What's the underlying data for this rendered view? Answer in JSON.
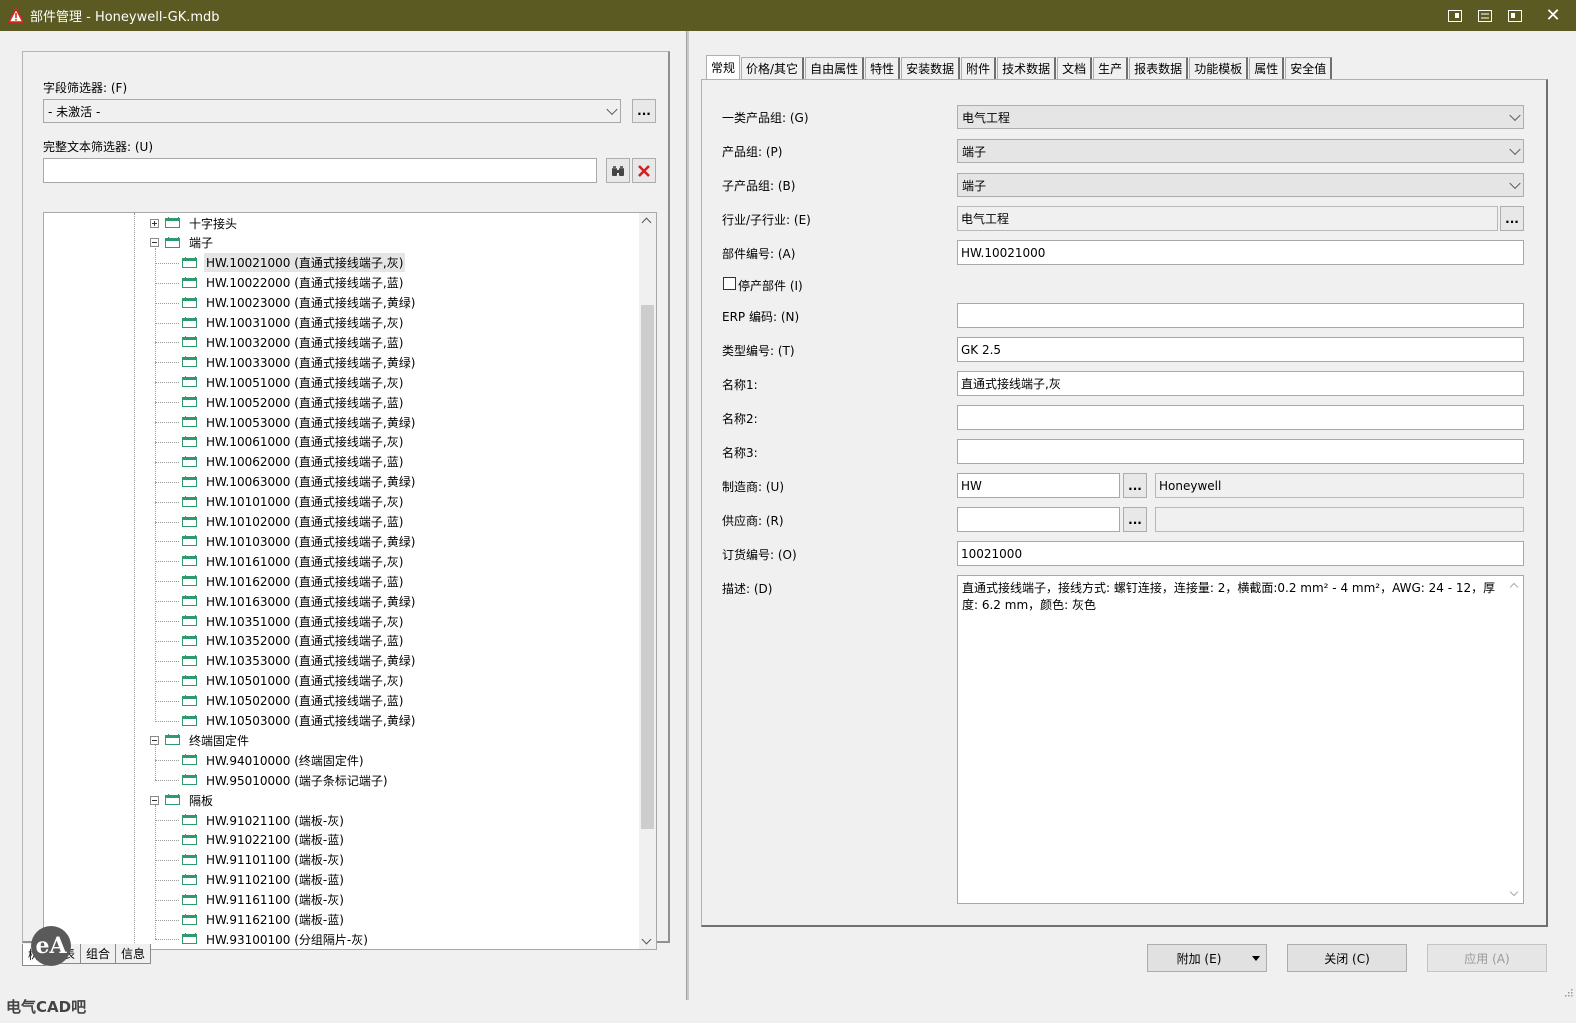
{
  "window": {
    "title": "部件管理 - Honeywell-GK.mdb",
    "buttons": [
      "restore-down",
      "maximize",
      "minimize",
      "close"
    ],
    "close_glyph": "✕"
  },
  "left": {
    "field_filter_label": "字段筛选器: (F)",
    "field_filter_value": "- 未激活 -",
    "field_filter_more": "...",
    "fulltext_filter_label": "完整文本筛选器: (U)",
    "fulltext_filter_value": "",
    "tree": {
      "groups": [
        {
          "label": "十字接头",
          "expanded": false
        },
        {
          "label": "端子",
          "expanded": true,
          "items": [
            "HW.10021000 (直通式接线端子,灰)",
            "HW.10022000 (直通式接线端子,蓝)",
            "HW.10023000 (直通式接线端子,黄绿)",
            "HW.10031000 (直通式接线端子,灰)",
            "HW.10032000 (直通式接线端子,蓝)",
            "HW.10033000 (直通式接线端子,黄绿)",
            "HW.10051000 (直通式接线端子,灰)",
            "HW.10052000 (直通式接线端子,蓝)",
            "HW.10053000 (直通式接线端子,黄绿)",
            "HW.10061000 (直通式接线端子,灰)",
            "HW.10062000 (直通式接线端子,蓝)",
            "HW.10063000 (直通式接线端子,黄绿)",
            "HW.10101000 (直通式接线端子,灰)",
            "HW.10102000 (直通式接线端子,蓝)",
            "HW.10103000 (直通式接线端子,黄绿)",
            "HW.10161000 (直通式接线端子,灰)",
            "HW.10162000 (直通式接线端子,蓝)",
            "HW.10163000 (直通式接线端子,黄绿)",
            "HW.10351000 (直通式接线端子,灰)",
            "HW.10352000 (直通式接线端子,蓝)",
            "HW.10353000 (直通式接线端子,黄绿)",
            "HW.10501000 (直通式接线端子,灰)",
            "HW.10502000 (直通式接线端子,蓝)",
            "HW.10503000 (直通式接线端子,黄绿)"
          ]
        },
        {
          "label": "终端固定件",
          "expanded": true,
          "items": [
            "HW.94010000 (终端固定件)",
            "HW.95010000 (端子条标记端子)"
          ]
        },
        {
          "label": "隔板",
          "expanded": true,
          "items": [
            "HW.91021100 (端板-灰)",
            "HW.91022100 (端板-蓝)",
            "HW.91101100 (端板-灰)",
            "HW.91102100 (端板-蓝)",
            "HW.91161100 (端板-灰)",
            "HW.91162100 (端板-蓝)",
            "HW.93100100 (分组隔片-灰)"
          ]
        }
      ],
      "selected": "HW.10021000 (直通式接线端子,灰)"
    },
    "bottom_tabs": [
      "树",
      "列表",
      "组合",
      "信息"
    ],
    "active_bottom_tab": "树"
  },
  "watermark": {
    "logo": "eA",
    "text": "电气CAD吧"
  },
  "right": {
    "tabs": [
      "常规",
      "价格/其它",
      "自由属性",
      "特性",
      "安装数据",
      "附件",
      "技术数据",
      "文档",
      "生产",
      "报表数据",
      "功能模板",
      "属性",
      "安全值"
    ],
    "active_tab": "常规",
    "fields": {
      "product_group_1": {
        "label": "一类产品组: (G)",
        "value": "电气工程"
      },
      "product_group": {
        "label": "产品组: (P)",
        "value": "端子"
      },
      "sub_product_group": {
        "label": "子产品组: (B)",
        "value": "端子"
      },
      "industry": {
        "label": "行业/子行业: (E)",
        "value": "电气工程"
      },
      "part_number": {
        "label": "部件编号: (A)",
        "value": "HW.10021000"
      },
      "discontinued": {
        "label": "停产部件 (I)",
        "checked": false
      },
      "erp_code": {
        "label": "ERP 编码: (N)",
        "value": ""
      },
      "type_number": {
        "label": "类型编号: (T)",
        "value": "GK 2.5"
      },
      "name1": {
        "label": "名称1:",
        "value": "直通式接线端子,灰"
      },
      "name2": {
        "label": "名称2:",
        "value": ""
      },
      "name3": {
        "label": "名称3:",
        "value": ""
      },
      "manufacturer": {
        "label": "制造商: (U)",
        "value": "HW",
        "display": "Honeywell"
      },
      "supplier": {
        "label": "供应商: (R)",
        "value": "",
        "display": ""
      },
      "order_number": {
        "label": "订货编号: (O)",
        "value": "10021000"
      },
      "description": {
        "label": "描述: (D)",
        "value": "直通式接线端子，接线方式: 螺钉连接，连接量: 2，横截面:0.2 mm² - 4 mm²，AWG: 24 - 12，厚度: 6.2 mm，颜色: 灰色"
      }
    },
    "more": "...",
    "buttons": {
      "add": "附加 (E)",
      "close": "关闭 (C)",
      "apply": "应用 (A)"
    }
  }
}
